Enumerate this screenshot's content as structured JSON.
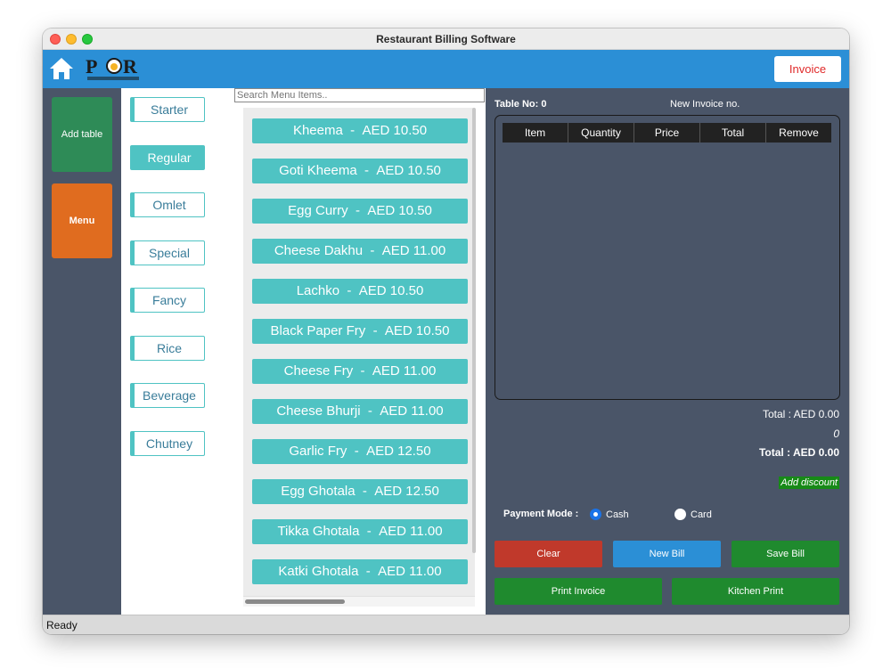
{
  "window": {
    "title": "Restaurant Billing Software"
  },
  "topbar": {
    "home_icon": "home-icon",
    "logo_text": "POR",
    "logo_subtext": "Pohe Onion Restaurant",
    "invoice_label": "Invoice",
    "accent_color": "#2b8fd6"
  },
  "sidebar": {
    "add_table_label": "Add table",
    "menu_label": "Menu"
  },
  "categories": [
    "Starter",
    "Regular",
    "Omlet",
    "Special",
    "Fancy",
    "Rice",
    "Beverage",
    "Chutney"
  ],
  "active_category": "Regular",
  "search": {
    "placeholder": "Search Menu Items.."
  },
  "menu_items": [
    {
      "name": "Kheema",
      "price": "AED 10.50"
    },
    {
      "name": "Goti Kheema",
      "price": "AED 10.50"
    },
    {
      "name": "Egg Curry",
      "price": "AED 10.50"
    },
    {
      "name": "Cheese Dakhu",
      "price": "AED 11.00"
    },
    {
      "name": "Lachko",
      "price": "AED 10.50"
    },
    {
      "name": "Black Paper Fry",
      "price": "AED 10.50"
    },
    {
      "name": "Cheese Fry",
      "price": "AED 11.00"
    },
    {
      "name": "Cheese Bhurji",
      "price": "AED 11.00"
    },
    {
      "name": "Garlic Fry",
      "price": "AED 12.50"
    },
    {
      "name": "Egg Ghotala",
      "price": "AED 12.50"
    },
    {
      "name": "Tikka Ghotala",
      "price": "AED 11.00"
    },
    {
      "name": "Katki Ghotala",
      "price": "AED 11.00"
    }
  ],
  "invoice": {
    "table_no_label": "Table No: 0",
    "invoice_no_label": "New Invoice no.",
    "columns": [
      "Item",
      "Quantity",
      "Price",
      "Total",
      "Remove"
    ],
    "subtotal_label": "Total : AED 0.00",
    "discount_value": "0",
    "grand_total_label": "Total : AED 0.00",
    "add_discount_label": "Add discount"
  },
  "payment": {
    "label": "Payment Mode :",
    "options": [
      "Cash",
      "Card"
    ],
    "selected": "Cash"
  },
  "actions": {
    "clear": "Clear",
    "new_bill": "New Bill",
    "save_bill": "Save Bill",
    "print_invoice": "Print Invoice",
    "kitchen_print": "Kitchen Print"
  },
  "status": {
    "text": "Ready"
  }
}
